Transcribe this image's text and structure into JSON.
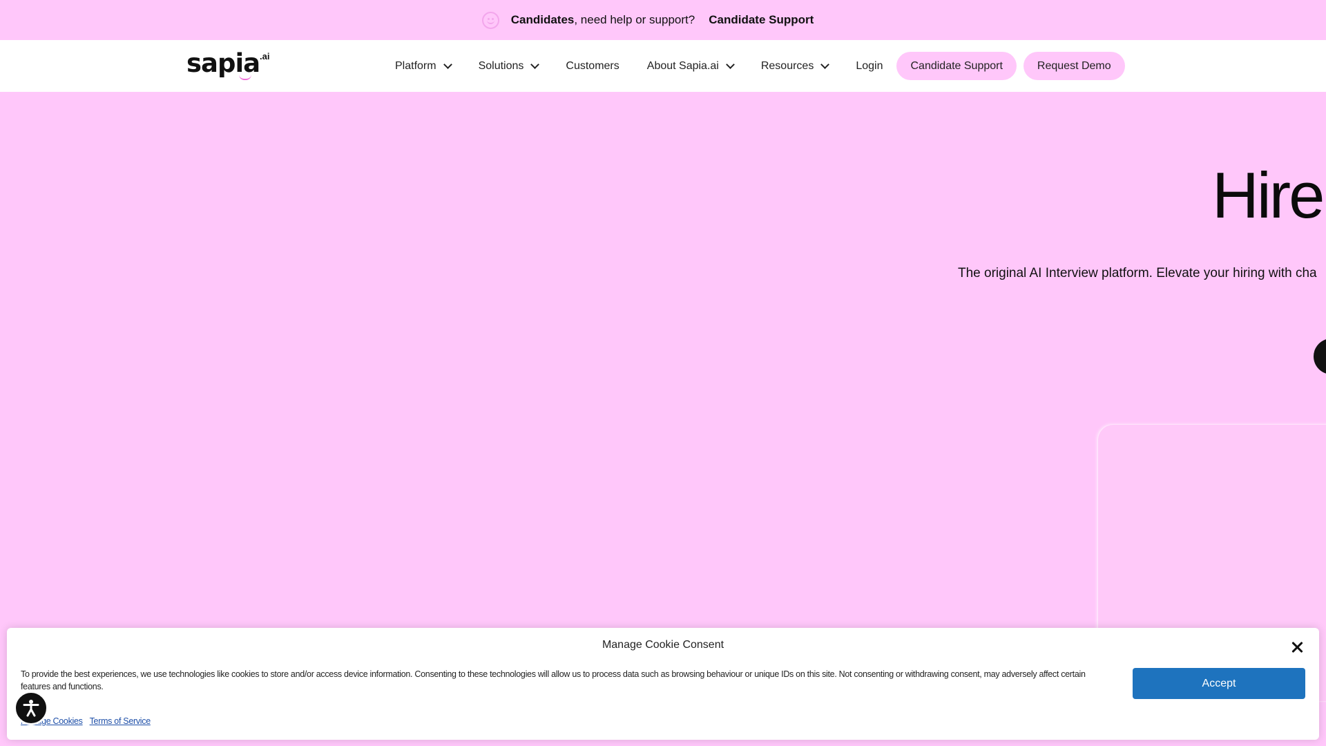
{
  "announcement": {
    "bold_text": "Candidates",
    "text": ", need help or support?",
    "link": "Candidate Support"
  },
  "header": {
    "logo_text": "sapia",
    "logo_suffix": ".ai",
    "nav": [
      {
        "label": "Platform",
        "dropdown": true
      },
      {
        "label": "Solutions",
        "dropdown": true
      },
      {
        "label": "Customers",
        "dropdown": false
      },
      {
        "label": "About Sapia.ai",
        "dropdown": true
      },
      {
        "label": "Resources",
        "dropdown": true
      },
      {
        "label": "Login",
        "dropdown": false
      }
    ],
    "buttons": {
      "candidate_support": "Candidate Support",
      "request_demo": "Request Demo"
    }
  },
  "hero": {
    "title": "Hire",
    "subtitle": "The original AI Interview platform. Elevate your hiring with cha"
  },
  "cookie_banner": {
    "title": "Manage Cookie Consent",
    "body": "To provide the best experiences, we use technologies like cookies to store and/or access device information. Consenting to these technologies will allow us to process data such as browsing behaviour or unique IDs on this site. Not consenting or withdrawing consent, may adversely affect certain features and functions.",
    "accept_label": "Accept",
    "links": [
      "Manage Cookies",
      "Terms of Service"
    ]
  },
  "colors": {
    "background": "#ffc7fa",
    "accent_button": "#1e73be",
    "pill": "#ffc7fa"
  },
  "icons": {
    "announcement": "smiley-icon",
    "accessibility": "accessibility-icon",
    "close": "close-icon"
  }
}
